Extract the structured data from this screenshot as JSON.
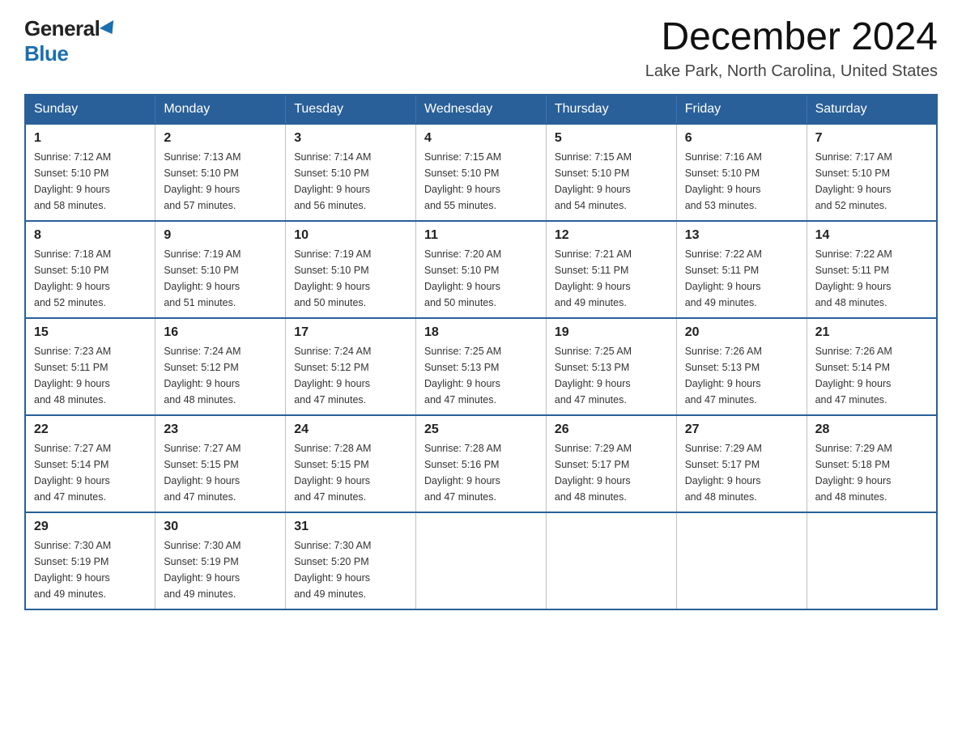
{
  "header": {
    "logo_general": "General",
    "logo_blue": "Blue",
    "month_title": "December 2024",
    "location": "Lake Park, North Carolina, United States"
  },
  "days_of_week": [
    "Sunday",
    "Monday",
    "Tuesday",
    "Wednesday",
    "Thursday",
    "Friday",
    "Saturday"
  ],
  "weeks": [
    [
      {
        "day": "1",
        "sunrise": "7:12 AM",
        "sunset": "5:10 PM",
        "daylight": "9 hours and 58 minutes."
      },
      {
        "day": "2",
        "sunrise": "7:13 AM",
        "sunset": "5:10 PM",
        "daylight": "9 hours and 57 minutes."
      },
      {
        "day": "3",
        "sunrise": "7:14 AM",
        "sunset": "5:10 PM",
        "daylight": "9 hours and 56 minutes."
      },
      {
        "day": "4",
        "sunrise": "7:15 AM",
        "sunset": "5:10 PM",
        "daylight": "9 hours and 55 minutes."
      },
      {
        "day": "5",
        "sunrise": "7:15 AM",
        "sunset": "5:10 PM",
        "daylight": "9 hours and 54 minutes."
      },
      {
        "day": "6",
        "sunrise": "7:16 AM",
        "sunset": "5:10 PM",
        "daylight": "9 hours and 53 minutes."
      },
      {
        "day": "7",
        "sunrise": "7:17 AM",
        "sunset": "5:10 PM",
        "daylight": "9 hours and 52 minutes."
      }
    ],
    [
      {
        "day": "8",
        "sunrise": "7:18 AM",
        "sunset": "5:10 PM",
        "daylight": "9 hours and 52 minutes."
      },
      {
        "day": "9",
        "sunrise": "7:19 AM",
        "sunset": "5:10 PM",
        "daylight": "9 hours and 51 minutes."
      },
      {
        "day": "10",
        "sunrise": "7:19 AM",
        "sunset": "5:10 PM",
        "daylight": "9 hours and 50 minutes."
      },
      {
        "day": "11",
        "sunrise": "7:20 AM",
        "sunset": "5:10 PM",
        "daylight": "9 hours and 50 minutes."
      },
      {
        "day": "12",
        "sunrise": "7:21 AM",
        "sunset": "5:11 PM",
        "daylight": "9 hours and 49 minutes."
      },
      {
        "day": "13",
        "sunrise": "7:22 AM",
        "sunset": "5:11 PM",
        "daylight": "9 hours and 49 minutes."
      },
      {
        "day": "14",
        "sunrise": "7:22 AM",
        "sunset": "5:11 PM",
        "daylight": "9 hours and 48 minutes."
      }
    ],
    [
      {
        "day": "15",
        "sunrise": "7:23 AM",
        "sunset": "5:11 PM",
        "daylight": "9 hours and 48 minutes."
      },
      {
        "day": "16",
        "sunrise": "7:24 AM",
        "sunset": "5:12 PM",
        "daylight": "9 hours and 48 minutes."
      },
      {
        "day": "17",
        "sunrise": "7:24 AM",
        "sunset": "5:12 PM",
        "daylight": "9 hours and 47 minutes."
      },
      {
        "day": "18",
        "sunrise": "7:25 AM",
        "sunset": "5:13 PM",
        "daylight": "9 hours and 47 minutes."
      },
      {
        "day": "19",
        "sunrise": "7:25 AM",
        "sunset": "5:13 PM",
        "daylight": "9 hours and 47 minutes."
      },
      {
        "day": "20",
        "sunrise": "7:26 AM",
        "sunset": "5:13 PM",
        "daylight": "9 hours and 47 minutes."
      },
      {
        "day": "21",
        "sunrise": "7:26 AM",
        "sunset": "5:14 PM",
        "daylight": "9 hours and 47 minutes."
      }
    ],
    [
      {
        "day": "22",
        "sunrise": "7:27 AM",
        "sunset": "5:14 PM",
        "daylight": "9 hours and 47 minutes."
      },
      {
        "day": "23",
        "sunrise": "7:27 AM",
        "sunset": "5:15 PM",
        "daylight": "9 hours and 47 minutes."
      },
      {
        "day": "24",
        "sunrise": "7:28 AM",
        "sunset": "5:15 PM",
        "daylight": "9 hours and 47 minutes."
      },
      {
        "day": "25",
        "sunrise": "7:28 AM",
        "sunset": "5:16 PM",
        "daylight": "9 hours and 47 minutes."
      },
      {
        "day": "26",
        "sunrise": "7:29 AM",
        "sunset": "5:17 PM",
        "daylight": "9 hours and 48 minutes."
      },
      {
        "day": "27",
        "sunrise": "7:29 AM",
        "sunset": "5:17 PM",
        "daylight": "9 hours and 48 minutes."
      },
      {
        "day": "28",
        "sunrise": "7:29 AM",
        "sunset": "5:18 PM",
        "daylight": "9 hours and 48 minutes."
      }
    ],
    [
      {
        "day": "29",
        "sunrise": "7:30 AM",
        "sunset": "5:19 PM",
        "daylight": "9 hours and 49 minutes."
      },
      {
        "day": "30",
        "sunrise": "7:30 AM",
        "sunset": "5:19 PM",
        "daylight": "9 hours and 49 minutes."
      },
      {
        "day": "31",
        "sunrise": "7:30 AM",
        "sunset": "5:20 PM",
        "daylight": "9 hours and 49 minutes."
      },
      null,
      null,
      null,
      null
    ]
  ],
  "labels": {
    "sunrise": "Sunrise:",
    "sunset": "Sunset:",
    "daylight": "Daylight:"
  }
}
